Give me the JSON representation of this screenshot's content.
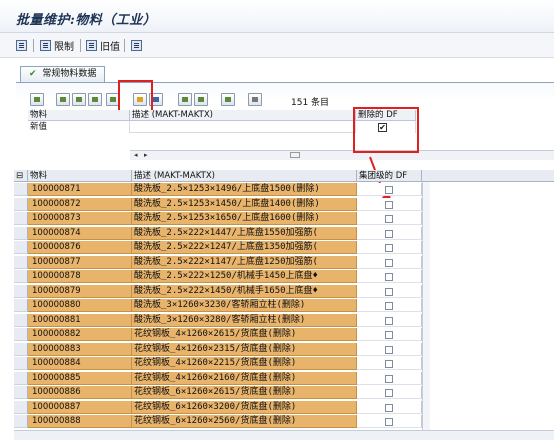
{
  "title": "批量维护:物料（工业）",
  "app_toolbar": {
    "restrict_label": "限制",
    "old_value_label": "旧值"
  },
  "tab": {
    "label": "常规物料数据"
  },
  "count_text": "151 条目",
  "upper": {
    "col_material": "物料",
    "col_desc": "描述 (MAKT-MAKTX)",
    "col_flag": "删除的 DF",
    "new_value_label": "新值",
    "flag_checked": true
  },
  "grid": {
    "headers": {
      "material": "物料",
      "desc": "描述 (MAKT-MAKTX)",
      "flag": "集团级的 DF"
    },
    "rows": [
      {
        "m": "100000871",
        "d": "酸洗板_2.5×1253×1496/上底盘1500(删除)"
      },
      {
        "m": "100000872",
        "d": "酸洗板_2.5×1253×1450/上底盘1400(删除)"
      },
      {
        "m": "100000873",
        "d": "酸洗板_2.5×1253×1650/上底盘1600(删除)"
      },
      {
        "m": "100000874",
        "d": "酸洗板_2.5×222×1447/上底盘1550加强筋("
      },
      {
        "m": "100000876",
        "d": "酸洗板_2.5×222×1247/上底盘1350加强筋("
      },
      {
        "m": "100000877",
        "d": "酸洗板_2.5×222×1147/上底盘1250加强筋("
      },
      {
        "m": "100000878",
        "d": "酸洗板_2.5×222×1250/机械手1450上底盘♦"
      },
      {
        "m": "100000879",
        "d": "酸洗板_2.5×222×1450/机械手1650上底盘♦"
      },
      {
        "m": "100000880",
        "d": "酸洗板_3×1260×3230/客轿厢立柱(删除)"
      },
      {
        "m": "100000881",
        "d": "酸洗板_3×1260×3280/客轿厢立柱(删除)"
      },
      {
        "m": "100000882",
        "d": "花纹钢板_4×1260×2615/货底盘(删除)"
      },
      {
        "m": "100000883",
        "d": "花纹钢板_4×1260×2315/货底盘(删除)"
      },
      {
        "m": "100000884",
        "d": "花纹钢板_4×1260×2215/货底盘(删除)"
      },
      {
        "m": "100000885",
        "d": "花纹钢板_4×1260×2160/货底盘(删除)"
      },
      {
        "m": "100000886",
        "d": "花纹钢板_6×1260×2615/货底盘(删除)"
      },
      {
        "m": "100000887",
        "d": "花纹钢板_6×1260×3200/货底盘(删除)"
      },
      {
        "m": "100000888",
        "d": "花纹钢板_6×1260×2560/货底盘(删除)"
      }
    ]
  },
  "colors": {
    "row_highlight": "#e8b36b",
    "annotation_red": "#e02020"
  }
}
